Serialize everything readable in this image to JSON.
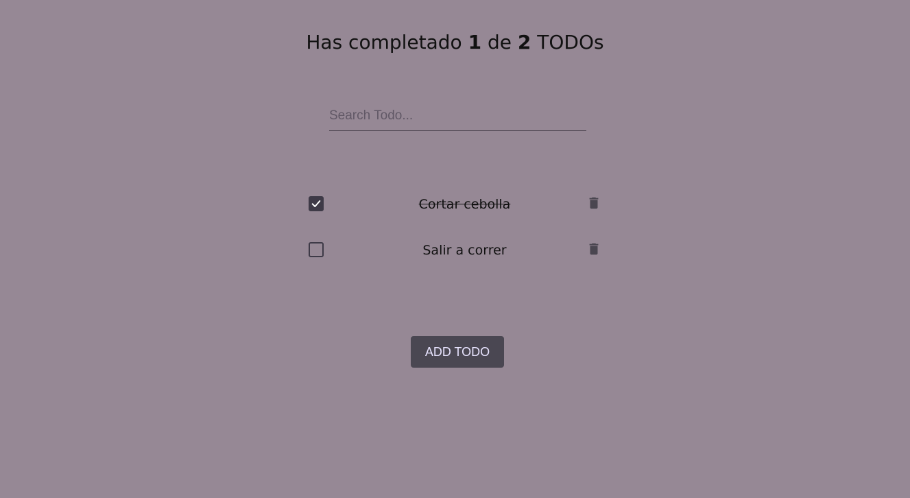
{
  "header": {
    "prefix": "Has completado",
    "completed": "1",
    "middle": "de",
    "total": "2",
    "suffix": "TODOs"
  },
  "search": {
    "placeholder": "Search Todo...",
    "value": ""
  },
  "todos": [
    {
      "text": "Cortar cebolla",
      "completed": true
    },
    {
      "text": "Salir a correr",
      "completed": false
    }
  ],
  "add_button": {
    "label": "ADD TODO"
  },
  "colors": {
    "background": "#968895",
    "checkbox": "#3e3a47",
    "icon": "#4a4650",
    "button_bg": "#4a4752",
    "button_text": "#e8e4ff"
  },
  "icons": {
    "check": "check-icon",
    "delete": "trash-icon"
  }
}
